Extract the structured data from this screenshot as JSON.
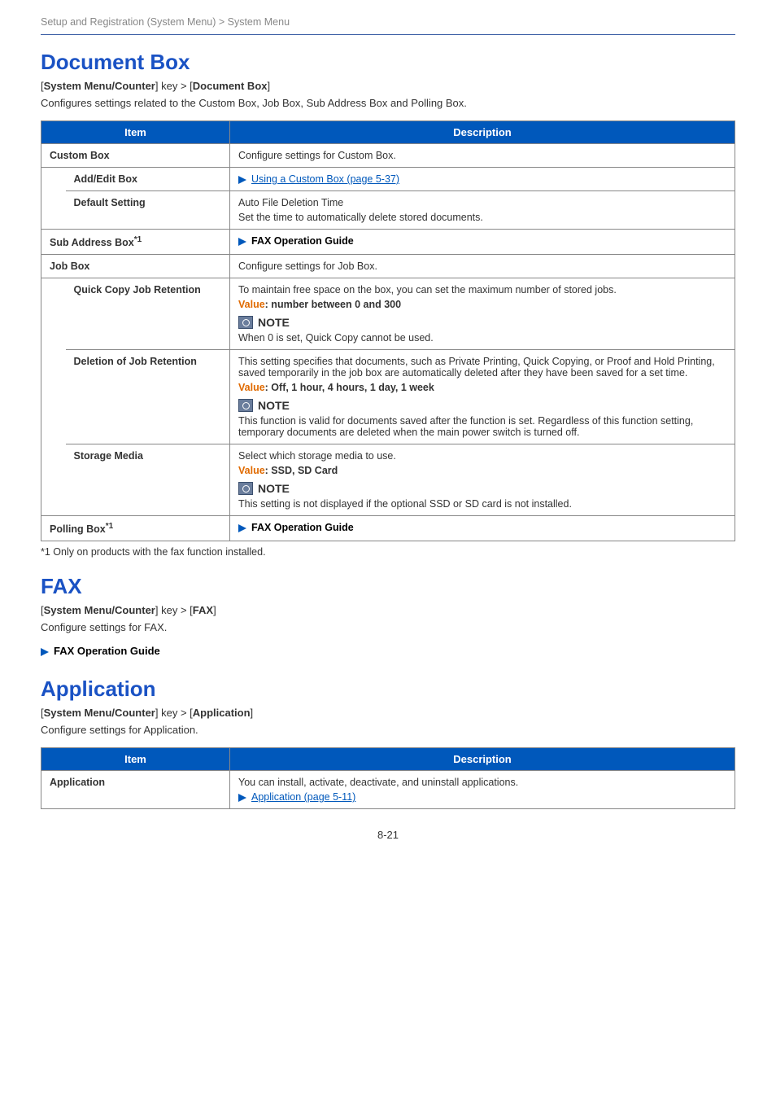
{
  "breadcrumb": "Setup and Registration (System Menu) > System Menu",
  "sections": {
    "docbox": {
      "heading": "Document Box",
      "path_pre": "[",
      "path_k1": "System Menu/Counter",
      "path_mid": "] key > [",
      "path_k2": "Document Box",
      "path_post": "]",
      "desc": "Configures settings related to the Custom Box, Job Box, Sub Address Box and Polling Box.",
      "table": {
        "headers": {
          "item": "Item",
          "desc": "Description"
        },
        "custom_box": {
          "label": "Custom Box",
          "desc": "Configure settings for Custom Box."
        },
        "add_edit": {
          "label": "Add/Edit Box",
          "link": "Using a Custom Box (page 5-37)"
        },
        "default_setting": {
          "label": "Default Setting",
          "l1": "Auto File Deletion Time",
          "l2": "Set the time to automatically delete stored documents."
        },
        "sub_addr": {
          "label": "Sub Address Box",
          "sup": "*1",
          "link": "FAX Operation Guide"
        },
        "job_box": {
          "label": "Job Box",
          "desc": "Configure settings for Job Box."
        },
        "quick_copy": {
          "label": "Quick Copy Job Retention",
          "l1": "To maintain free space on the box, you can set the maximum number of stored jobs.",
          "value_prefix": "Value",
          "value_txt": ": number between 0 and 300",
          "note": "NOTE",
          "note_txt": "When 0 is set, Quick Copy cannot be used."
        },
        "deletion": {
          "label": "Deletion of Job Retention",
          "l1": "This setting specifies that documents, such as Private Printing, Quick Copying, or Proof and Hold Printing, saved temporarily in the job box are automatically deleted after they have been saved for a set time.",
          "value_prefix": "Value",
          "value_txt": ": Off, 1 hour, 4 hours, 1 day, 1 week",
          "note": "NOTE",
          "note_txt": "This function is valid for documents saved after the function is set. Regardless of this function setting, temporary documents are deleted when the main power switch is turned off."
        },
        "storage": {
          "label": "Storage Media",
          "l1": "Select which storage media to use.",
          "value_prefix": "Value",
          "value_txt": ": SSD, SD Card",
          "note": "NOTE",
          "note_txt": "This setting is not displayed if the optional SSD or SD card is not installed."
        },
        "polling": {
          "label": "Polling Box",
          "sup": "*1",
          "link": "FAX Operation Guide"
        }
      },
      "footnote": "*1   Only on products with the fax function installed."
    },
    "fax": {
      "heading": "FAX",
      "path_k1": "System Menu/Counter",
      "path_k2": "FAX",
      "desc": "Configure settings for FAX.",
      "link": "FAX Operation Guide"
    },
    "app": {
      "heading": "Application",
      "path_k1": "System Menu/Counter",
      "path_k2": "Application",
      "desc": "Configure settings for Application.",
      "table": {
        "headers": {
          "item": "Item",
          "desc": "Description"
        },
        "row": {
          "label": "Application",
          "desc": "You can install, activate, deactivate, and uninstall applications.",
          "link": "Application (page 5-11)"
        }
      }
    }
  },
  "page_num": "8-21"
}
